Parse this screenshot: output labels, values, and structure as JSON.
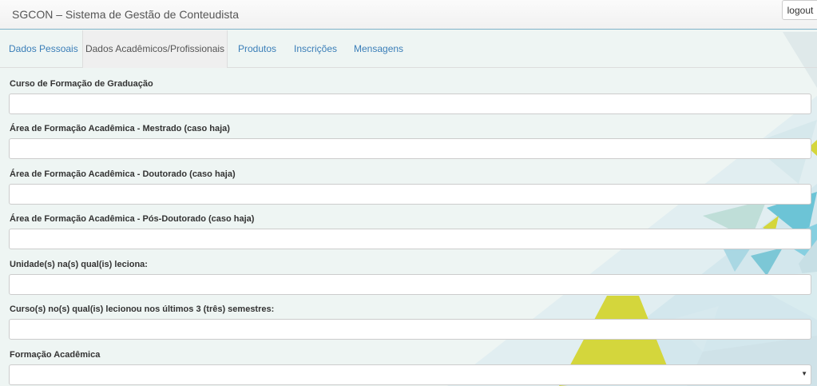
{
  "app": {
    "title": "SGCON – Sistema de Gestão de Conteudista",
    "logout_label": "logout"
  },
  "tabs": [
    {
      "label": "Dados Pessoais",
      "active": false
    },
    {
      "label": "Dados Acadêmicos/Profissionais",
      "active": true
    },
    {
      "label": "Produtos",
      "active": false
    },
    {
      "label": "Inscrições",
      "active": false
    },
    {
      "label": "Mensagens",
      "active": false
    }
  ],
  "form": {
    "fields": [
      {
        "label": "Curso de Formação de Graduação",
        "value": ""
      },
      {
        "label": "Área de Formação Acadêmica - Mestrado (caso haja)",
        "value": ""
      },
      {
        "label": "Área de Formação Acadêmica - Doutorado (caso haja)",
        "value": ""
      },
      {
        "label": "Área de Formação Acadêmica - Pós-Doutorado (caso haja)",
        "value": ""
      },
      {
        "label": "Unidade(s) na(s) qual(is) leciona:",
        "value": ""
      },
      {
        "label": "Curso(s) no(s) qual(is) lecionou nos últimos 3 (três) semestres:",
        "value": ""
      }
    ],
    "select": {
      "label": "Formação Acadêmica",
      "selected": ""
    }
  },
  "colors": {
    "link": "#3a7eb8",
    "accent_teal": "#7cc7d6",
    "accent_yellow": "#d4d63c"
  }
}
